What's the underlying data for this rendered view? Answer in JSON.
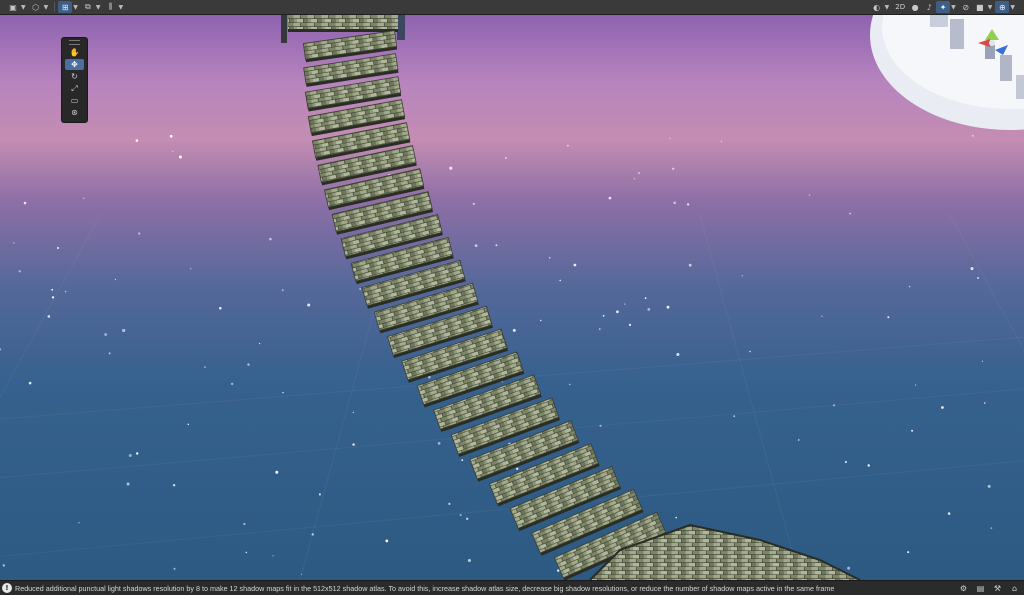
{
  "toolbar_left": {
    "groups": [
      {
        "name": "draw-mode",
        "icon": "shaded-icon"
      },
      {
        "name": "gizmo-mode",
        "icon": "cube-icon"
      },
      {
        "name": "snap",
        "icon": "grid-snap-icon"
      },
      {
        "name": "increment",
        "icon": "increment-icon"
      },
      {
        "name": "align",
        "icon": "align-icon"
      }
    ]
  },
  "toolbar_right": {
    "two_d_label": "2D",
    "items": [
      "lighting-icon",
      "audio-icon",
      "effects-icon",
      "hidden-icon",
      "camera-icon",
      "gizmos-icon"
    ]
  },
  "tools": [
    "hand-icon",
    "move-icon",
    "rotate-icon",
    "scale-icon",
    "rect-icon",
    "transform-icon"
  ],
  "status": {
    "message": "Reduced additional punctual light shadows resolution by 8 to make 12 shadow maps fit in the 512x512 shadow atlas. To avoid this, increase shadow atlas size, decrease big shadow resolutions, or reduce the number of shadow maps active in the same frame"
  },
  "colors": {
    "sky_top": "#8a5fa8",
    "sky_mid": "#b77fb6",
    "sky_low": "#4f6b9a",
    "floor": "#2f5f86",
    "plank": "#8e977a",
    "plank_dark": "#2a2d24",
    "accent": "#3d5f87"
  }
}
